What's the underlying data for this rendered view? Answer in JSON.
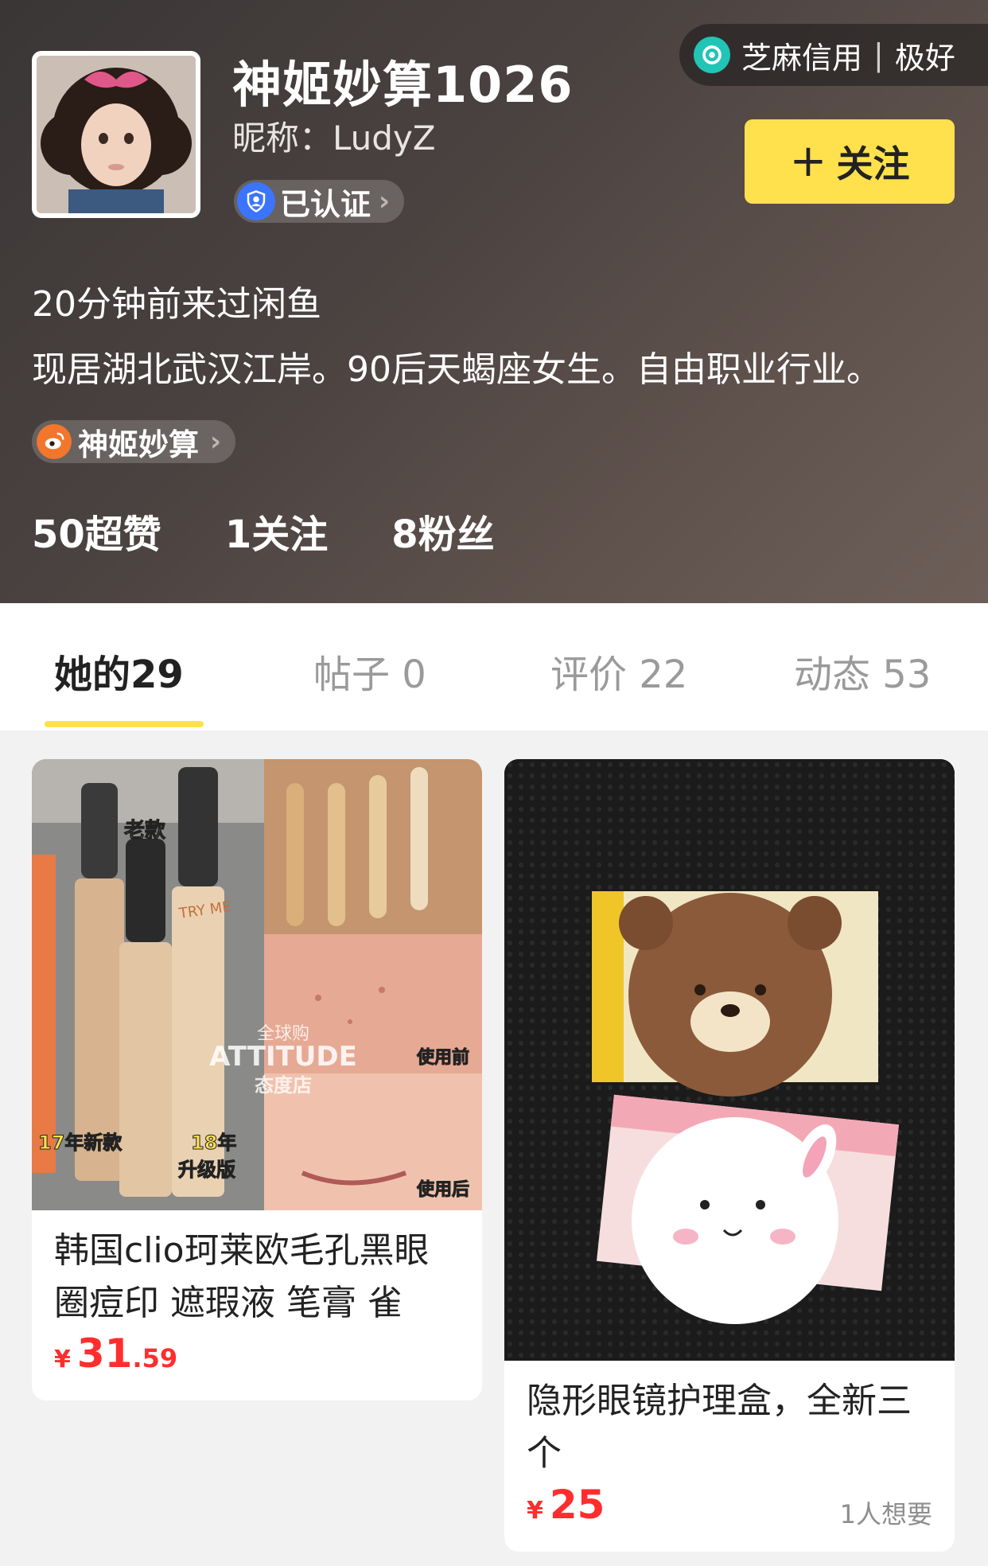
{
  "profile": {
    "username": "神姬妙算1026",
    "nickname": "昵称：LudyZ",
    "verified_label": "已认证",
    "credit_label": "芝麻信用",
    "credit_level": "极好",
    "follow_label": "关注",
    "last_seen": "20分钟前来过闲鱼",
    "bio": "现居湖北武汉江岸。90后天蝎座女生。自由职业行业。",
    "weibo_label": "神姬妙算",
    "stats": {
      "likes": "50超赞",
      "following": "1关注",
      "fans": "8粉丝"
    }
  },
  "tabs": [
    {
      "label": "她的29",
      "active": true
    },
    {
      "label": "帖子 0",
      "active": false
    },
    {
      "label": "评价 22",
      "active": false
    },
    {
      "label": "动态 53",
      "active": false
    }
  ],
  "items": [
    {
      "title": "韩国clio珂莱欧毛孔黑眼圈痘印 遮瑕液 笔膏 雀",
      "currency": "¥",
      "price_int": "31",
      "price_dec": ".59",
      "wants": "",
      "image_text": {
        "old": "老款",
        "new17": "17年新款",
        "upgrade18a": "18年",
        "upgrade18b": "升级版",
        "before": "使用前",
        "after": "使用后",
        "watermark": "ATTITUDE",
        "watermark_sub": "全球购",
        "watermark_shop": "态度店",
        "brand": "TRY ME"
      }
    },
    {
      "title": "隐形眼镜护理盒，全新三个",
      "currency": "¥",
      "price_int": "25",
      "price_dec": "",
      "wants": "1人想要"
    }
  ]
}
